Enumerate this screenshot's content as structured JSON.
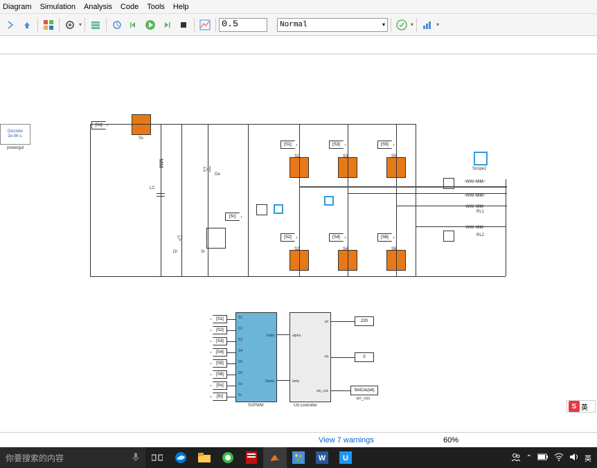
{
  "menu": {
    "items": [
      "Diagram",
      "Simulation",
      "Analysis",
      "Code",
      "Tools",
      "Help"
    ]
  },
  "toolbar": {
    "stop_time": "0.5",
    "mode": "Normal"
  },
  "canvas": {
    "powergui": {
      "line1": "Discrete",
      "line2": "2e-06 s.",
      "label": "powergui"
    },
    "goto_from": {
      "Ss": "[Ss]",
      "S1": "[S1]",
      "S2": "[S2]",
      "S3": "[S3]",
      "S4": "[S4]",
      "S5": "[S5]",
      "S6": "[S6]",
      "Sr": "[Sr]"
    },
    "igbt": {
      "Ss": "Ss",
      "S1": "S1",
      "S2": "S2",
      "S3": "S3",
      "S4": "S4",
      "S5": "S5",
      "S6": "S6",
      "Sr": "Sr"
    },
    "labels": {
      "Da": "Da",
      "Dr": "Dr",
      "LC": "LC",
      "RL1": "RL1",
      "RL2": "RL2",
      "Scope2": "Scope2"
    },
    "svpwm": {
      "name": "SVPWM",
      "ports": [
        "S1",
        "S2",
        "S3",
        "S4",
        "S5",
        "S6",
        "Ss",
        "Sr"
      ],
      "in": [
        "Ualfa",
        "Ubeta"
      ]
    },
    "udctrl": {
      "name": "Ud controller",
      "in": [
        "alpha",
        "beta"
      ],
      "out": [
        "ud",
        "uq",
        "sin_cos"
      ]
    },
    "const": {
      "ud": "220",
      "uq": "0",
      "sincoswt": "SinCos(wt)",
      "sin_cos": "sin_cos"
    },
    "ctrl_from": [
      "[S1]",
      "[S2]",
      "[S3]",
      "[S4]",
      "[S5]",
      "[S6]",
      "[Ss]",
      "[Sr]"
    ]
  },
  "status": {
    "warnings": "View 7 warnings",
    "zoom": "60%"
  },
  "taskbar": {
    "search_placeholder": "你要搜索的内容",
    "tray": "英"
  }
}
